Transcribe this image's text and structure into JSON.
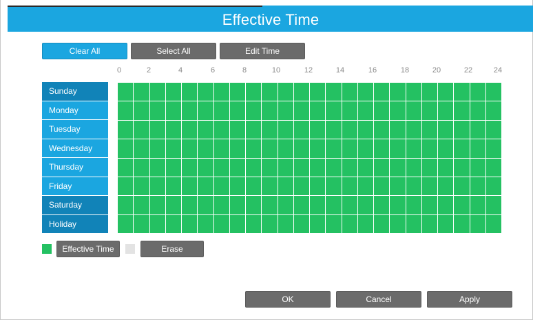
{
  "dialog": {
    "title": "Effective Time"
  },
  "toolbar": {
    "clear_all": "Clear All",
    "select_all": "Select All",
    "edit_time": "Edit Time"
  },
  "hours": [
    "0",
    "2",
    "4",
    "6",
    "8",
    "10",
    "12",
    "14",
    "16",
    "18",
    "20",
    "22",
    "24"
  ],
  "days": [
    "Sunday",
    "Monday",
    "Tuesday",
    "Wednesday",
    "Thursday",
    "Friday",
    "Saturday",
    "Holiday"
  ],
  "legend": {
    "effective_time": "Effective Time",
    "erase": "Erase"
  },
  "footer": {
    "ok": "OK",
    "cancel": "Cancel",
    "apply": "Apply"
  },
  "colors": {
    "accent": "#1ba6e0",
    "accent_dark": "#1183b8",
    "effective": "#24c162",
    "button_gray": "#6b6b6b",
    "erase_swatch": "#e3e3e3"
  }
}
